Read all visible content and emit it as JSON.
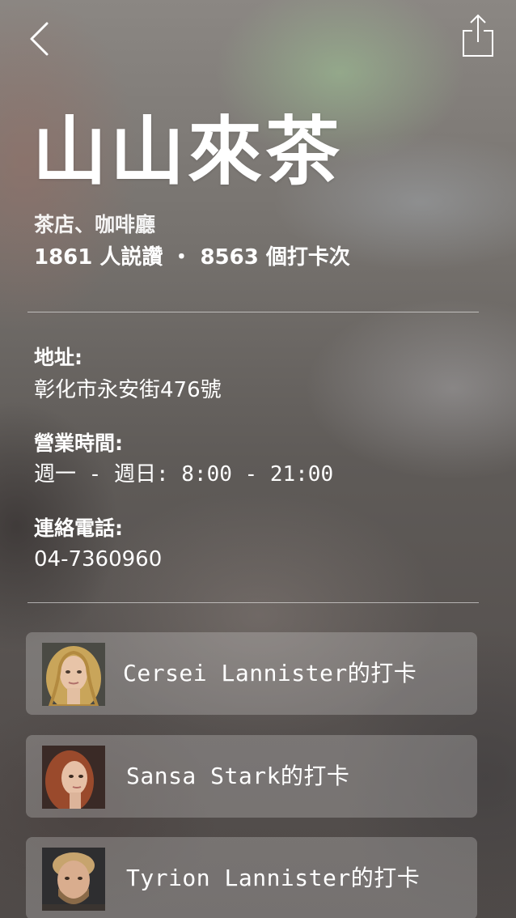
{
  "header": {
    "back_icon": "chevron-left-icon",
    "share_icon": "share-icon"
  },
  "place": {
    "name": "山山來茶",
    "category": "茶店、咖啡廳",
    "likes": "1861 人説讚",
    "separator": "・",
    "checkins": "8563 個打卡次"
  },
  "info": {
    "address_label": "地址:",
    "address_value": "彰化市永安街476號",
    "hours_label": "營業時間:",
    "hours_value": "週一 - 週日: 8:00 - 21:00",
    "phone_label": "連絡電話:",
    "phone_value": "04-7360960"
  },
  "checkins_list": [
    {
      "label": "Cersei Lannister的打卡"
    },
    {
      "label": "Sansa Stark的打卡"
    },
    {
      "label": "Tyrion Lannister的打卡"
    }
  ],
  "colors": {
    "text": "#ffffff",
    "card_bg": "rgba(255,255,255,0.22)",
    "divider": "rgba(255,255,255,0.55)"
  }
}
